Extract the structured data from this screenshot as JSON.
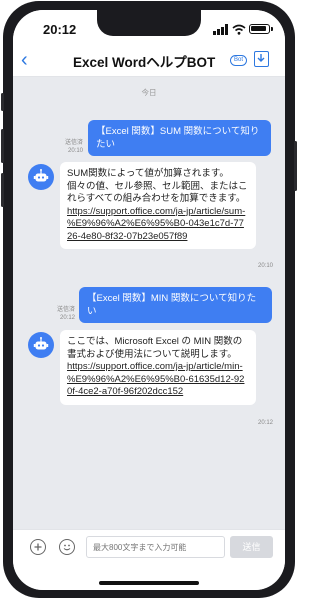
{
  "status": {
    "time": "20:12"
  },
  "header": {
    "back_icon": "‹",
    "title": "Excel WordヘルプBOT",
    "badge": "Bot"
  },
  "chat": {
    "date_label": "今日",
    "messages": [
      {
        "sender": "user",
        "status": "送信済",
        "time": "20:10",
        "text": "【Excel 関数】SUM 関数について知りたい"
      },
      {
        "sender": "bot",
        "time": "20:10",
        "text": "SUM関数によって値が加算されます。 個々の値、セル参照、セル範囲、またはこれらすべての組み合わせを加算できます。",
        "link": "https://support.office.com/ja-jp/article/sum-%E9%96%A2%E6%95%B0-043e1c7d-7726-4e80-8f32-07b23e057f89"
      },
      {
        "sender": "user",
        "status": "送信済",
        "time": "20:12",
        "text": "【Excel 関数】MIN 関数について知りたい"
      },
      {
        "sender": "bot",
        "time": "20:12",
        "text": "ここでは、Microsoft Excel の MIN 関数の書式および使用法について説明します。",
        "link": "https://support.office.com/ja-jp/article/min-%E9%96%A2%E6%95%B0-61635d12-920f-4ce2-a70f-96f202dcc152"
      }
    ]
  },
  "input": {
    "placeholder": "最大800文字まで入力可能",
    "send_label": "送信"
  },
  "colors": {
    "accent": "#3f7ef2",
    "link_blue": "#2d78e0",
    "chat_bg": "#e8eaee"
  }
}
